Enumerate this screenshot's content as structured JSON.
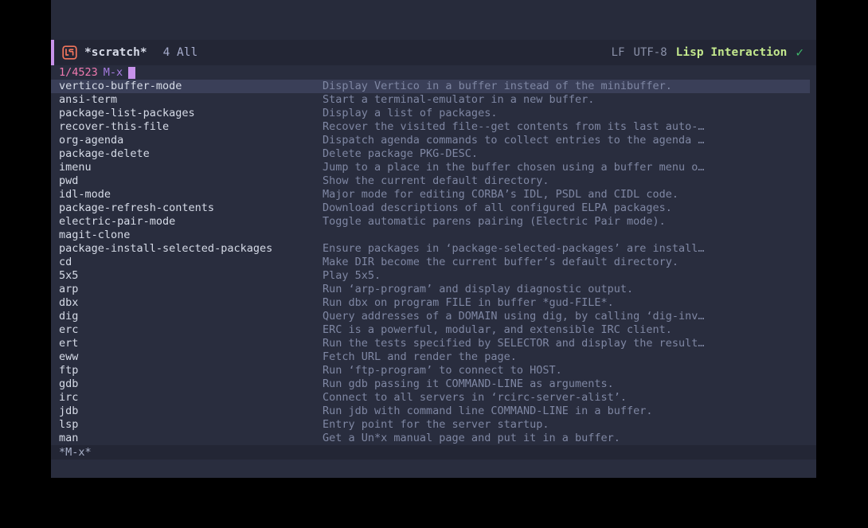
{
  "window": {
    "header": {
      "icon": "lisp-file-icon",
      "buffer_name": "*scratch*",
      "position": "4 All",
      "line_ending": "LF",
      "encoding": "UTF-8",
      "major_mode": "Lisp Interaction",
      "status_icon": "checkmark-icon"
    },
    "prompt": {
      "count": "1/4523",
      "label": "M-x",
      "input_value": ""
    },
    "bottom_modeline": {
      "buffer_label": "*M-x*"
    }
  },
  "candidates": [
    {
      "name": "vertico-buffer-mode",
      "desc": "Display Vertico in a buffer instead of the minibuffer.",
      "selected": true
    },
    {
      "name": "ansi-term",
      "desc": "Start a terminal-emulator in a new buffer.",
      "selected": false
    },
    {
      "name": "package-list-packages",
      "desc": "Display a list of packages.",
      "selected": false
    },
    {
      "name": "recover-this-file",
      "desc": "Recover the visited file--get contents from its last auto-…",
      "selected": false
    },
    {
      "name": "org-agenda",
      "desc": "Dispatch agenda commands to collect entries to the agenda …",
      "selected": false
    },
    {
      "name": "package-delete",
      "desc": "Delete package PKG-DESC.",
      "selected": false
    },
    {
      "name": "imenu",
      "desc": "Jump to a place in the buffer chosen using a buffer menu o…",
      "selected": false
    },
    {
      "name": "pwd",
      "desc": "Show the current default directory.",
      "selected": false
    },
    {
      "name": "idl-mode",
      "desc": "Major mode for editing CORBA’s IDL, PSDL and CIDL code.",
      "selected": false
    },
    {
      "name": "package-refresh-contents",
      "desc": "Download descriptions of all configured ELPA packages.",
      "selected": false
    },
    {
      "name": "electric-pair-mode",
      "desc": "Toggle automatic parens pairing (Electric Pair mode).",
      "selected": false
    },
    {
      "name": "magit-clone",
      "desc": "",
      "selected": false
    },
    {
      "name": "package-install-selected-packages",
      "desc": "Ensure packages in ‘package-selected-packages’ are install…",
      "selected": false
    },
    {
      "name": "cd",
      "desc": "Make DIR become the current buffer’s default directory.",
      "selected": false
    },
    {
      "name": "5x5",
      "desc": "Play 5x5.",
      "selected": false
    },
    {
      "name": "arp",
      "desc": "Run ‘arp-program’ and display diagnostic output.",
      "selected": false
    },
    {
      "name": "dbx",
      "desc": "Run dbx on program FILE in buffer *gud-FILE*.",
      "selected": false
    },
    {
      "name": "dig",
      "desc": "Query addresses of a DOMAIN using dig, by calling ‘dig-inv…",
      "selected": false
    },
    {
      "name": "erc",
      "desc": "ERC is a powerful, modular, and extensible IRC client.",
      "selected": false
    },
    {
      "name": "ert",
      "desc": "Run the tests specified by SELECTOR and display the result…",
      "selected": false
    },
    {
      "name": "eww",
      "desc": "Fetch URL and render the page.",
      "selected": false
    },
    {
      "name": "ftp",
      "desc": "Run ‘ftp-program’ to connect to HOST.",
      "selected": false
    },
    {
      "name": "gdb",
      "desc": "Run gdb passing it COMMAND-LINE as arguments.",
      "selected": false
    },
    {
      "name": "irc",
      "desc": "Connect to all servers in ‘rcirc-server-alist’.",
      "selected": false
    },
    {
      "name": "jdb",
      "desc": "Run jdb with command line COMMAND-LINE in a buffer.",
      "selected": false
    },
    {
      "name": "lsp",
      "desc": "Entry point for the server startup.",
      "selected": false
    },
    {
      "name": "man",
      "desc": "Get a Un*x manual page and put it in a buffer.",
      "selected": false
    }
  ],
  "colors": {
    "background": "#292d3e",
    "modeline_bg": "#232635",
    "selection": "#3a3f58",
    "accent_purple": "#c792ea",
    "prompt_pink": "#f07ab0",
    "mode_green": "#c3e88d",
    "check_green": "#3fba6b",
    "icon_orange": "#f2755c",
    "text_primary": "#d6dbe7",
    "text_muted": "#7f87a3"
  }
}
